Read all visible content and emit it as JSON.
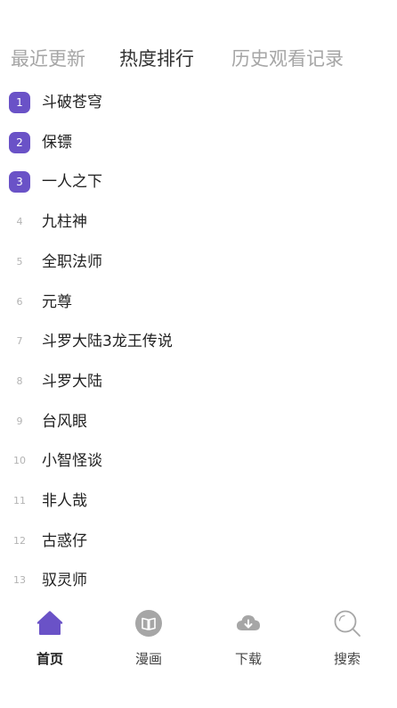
{
  "tabs": [
    {
      "label": "最近更新"
    },
    {
      "label": "热度排行"
    },
    {
      "label": "历史观看记录"
    }
  ],
  "active_tab": 1,
  "ranking": [
    {
      "rank": "1",
      "title": "斗破苍穹"
    },
    {
      "rank": "2",
      "title": "保镖"
    },
    {
      "rank": "3",
      "title": "一人之下"
    },
    {
      "rank": "4",
      "title": "九柱神"
    },
    {
      "rank": "5",
      "title": "全职法师"
    },
    {
      "rank": "6",
      "title": "元尊"
    },
    {
      "rank": "7",
      "title": "斗罗大陆3龙王传说"
    },
    {
      "rank": "8",
      "title": "斗罗大陆"
    },
    {
      "rank": "9",
      "title": "台风眼"
    },
    {
      "rank": "10",
      "title": "小智怪谈"
    },
    {
      "rank": "11",
      "title": "非人哉"
    },
    {
      "rank": "12",
      "title": "古惑仔"
    },
    {
      "rank": "13",
      "title": "驭灵师"
    }
  ],
  "nav": [
    {
      "label": "首页",
      "icon": "home-icon"
    },
    {
      "label": "漫画",
      "icon": "book-icon"
    },
    {
      "label": "下载",
      "icon": "cloud-download-icon"
    },
    {
      "label": "搜索",
      "icon": "search-icon"
    }
  ],
  "colors": {
    "accent": "#6a52c7",
    "inactive_icon": "#a6a6a6",
    "tab_inactive": "#a6a6a6",
    "tab_active": "#333333"
  }
}
